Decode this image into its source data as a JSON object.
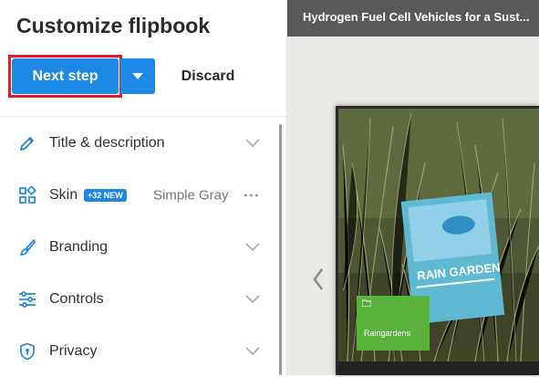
{
  "panel": {
    "title": "Customize flipbook",
    "next_step_label": "Next step",
    "discard_label": "Discard"
  },
  "menu": {
    "items": [
      {
        "label": "Title & description",
        "icon": "pencil-icon"
      },
      {
        "label": "Skin",
        "icon": "skin-grid-icon",
        "badge": "+32 NEW",
        "value": "Simple Gray"
      },
      {
        "label": "Branding",
        "icon": "brush-icon"
      },
      {
        "label": "Controls",
        "icon": "sliders-icon"
      },
      {
        "label": "Privacy",
        "icon": "shield-lock-icon"
      }
    ]
  },
  "preview": {
    "document_title": "Hydrogen Fuel Cell Vehicles for a Sust...",
    "cover_label": "Raingardens",
    "sign_text": "RAIN GARDEN"
  },
  "colors": {
    "accent": "#1e88e5",
    "highlight": "#e01b2b",
    "preview_bar": "#595959"
  }
}
